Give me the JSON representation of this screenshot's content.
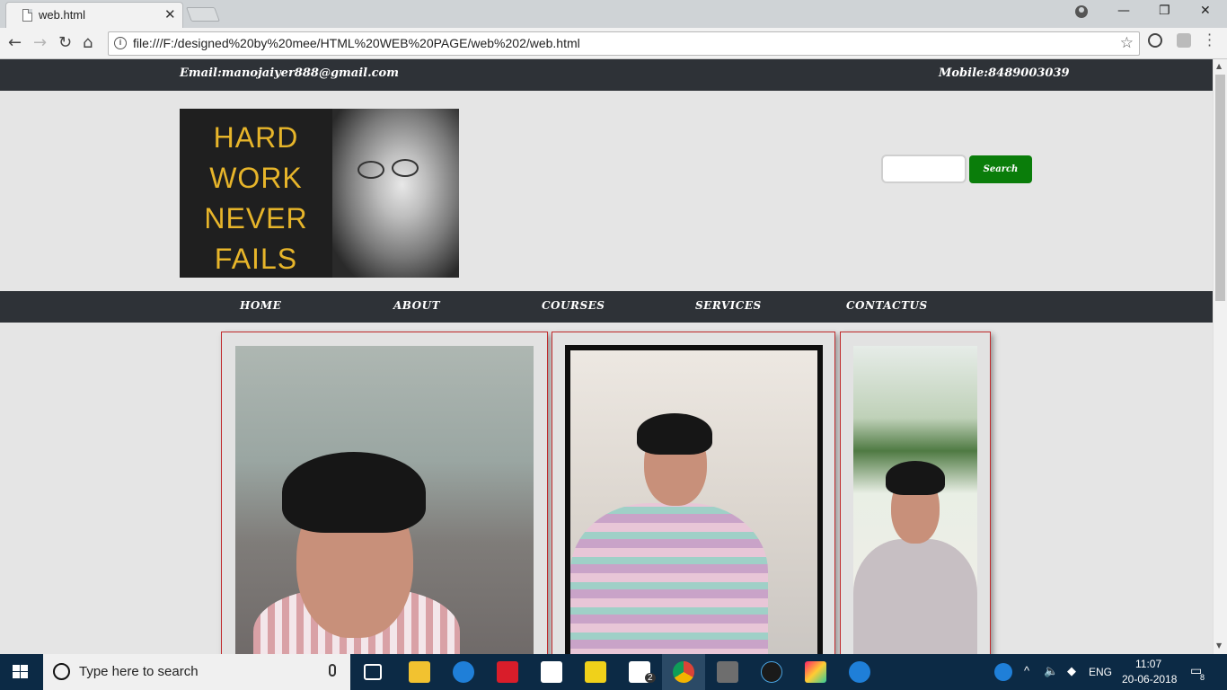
{
  "browser": {
    "tab_title": "web.html",
    "tab_close": "✕",
    "url": "file:///F:/designed%20by%20mee/HTML%20WEB%20PAGE/web%202/web.html",
    "window_minimize": "—",
    "window_restore": "❐",
    "window_close": "✕"
  },
  "site": {
    "topbar": {
      "email": "Email:manojaiyer888@gmail.com",
      "mobile": "Mobile:8489003039"
    },
    "logo_lines": [
      "HARD",
      "WORK",
      "NEVER",
      "FAILS"
    ],
    "search": {
      "input_value": "",
      "button_label": "Search"
    },
    "nav": [
      "HOME",
      "ABOUT",
      "COURSES",
      "SERVICES",
      "CONTACTUS"
    ]
  },
  "taskbar": {
    "search_placeholder": "Type here to search",
    "mail_badge": "2",
    "language": "ENG",
    "time": "11:07",
    "date": "20-06-2018",
    "notification_count": "8"
  },
  "colors": {
    "dark_bar": "#2e3237",
    "search_button": "#0a7d0a",
    "card_border": "#c0292b",
    "logo_text": "#e7b52a"
  }
}
